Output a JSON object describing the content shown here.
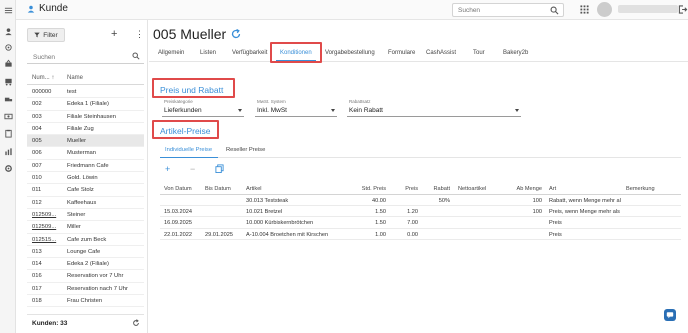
{
  "app": {
    "title": "Kunde"
  },
  "top": {
    "search_placeholder": "Suchen"
  },
  "listpanel": {
    "filter_label": "Filter",
    "search_placeholder": "Suchen",
    "col_num": "Num...",
    "col_name": "Name",
    "sort_indicator": "↑",
    "footer": "Kunden: 33",
    "rows": [
      {
        "num": "000000",
        "name": "test"
      },
      {
        "num": "002",
        "name": "Edeka 1 (Filiale)"
      },
      {
        "num": "003",
        "name": "Filiale Steinhausen"
      },
      {
        "num": "004",
        "name": "Filiale Zug"
      },
      {
        "num": "005",
        "name": "Mueller"
      },
      {
        "num": "006",
        "name": "Musterman"
      },
      {
        "num": "007",
        "name": "Friedmann Cafe"
      },
      {
        "num": "010",
        "name": "Gold. Löwin"
      },
      {
        "num": "011",
        "name": "Cafe Stolz"
      },
      {
        "num": "012",
        "name": "Kaffeehaus"
      },
      {
        "num": "012509...",
        "name": "Steiner"
      },
      {
        "num": "012509...",
        "name": "Miller"
      },
      {
        "num": "012515...",
        "name": "Cafe zum Beck"
      },
      {
        "num": "013",
        "name": "Lounge Cafe"
      },
      {
        "num": "014",
        "name": "Edeka 2 (Filiale)"
      },
      {
        "num": "016",
        "name": "Reservation vor 7 Uhr"
      },
      {
        "num": "017",
        "name": "Reservation nach 7 Uhr"
      },
      {
        "num": "018",
        "name": "Frau Christen"
      }
    ]
  },
  "main": {
    "title": "005 Mueller",
    "tabs": [
      "Allgemein",
      "Listen",
      "Verfügbarkeit",
      "Konditionen",
      "Vorgabebestellung",
      "Formulare",
      "CashAssist",
      "Tour",
      "Bakery2b"
    ],
    "active_tab": "Konditionen",
    "section_price": "Preis und Rabatt",
    "section_articles": "Artikel-Preise",
    "dropdowns": [
      {
        "label": "Preiskategorie",
        "value": "Lieferkunden"
      },
      {
        "label": "MwSt. System",
        "value": "Inkl. MwSt"
      },
      {
        "label": "Rabattsatz",
        "value": "Kein Rabatt"
      }
    ],
    "subtabs": [
      "Individuelle Preise",
      "Reseller Preise"
    ],
    "grid": {
      "headers": [
        "Von Datum",
        "Bis Datum",
        "Artikel",
        "Std. Preis",
        "Preis",
        "Rabatt",
        "Nettoartikel",
        "Ab Menge",
        "Art",
        "Bemerkung"
      ],
      "rows": [
        [
          "",
          "",
          "30.013 Teststeak",
          "40.00",
          "",
          "50%",
          "",
          "100",
          "Rabatt, wenn Menge mehr al",
          ""
        ],
        [
          "15.03.2024",
          "",
          "10.021 Bretzel",
          "1.50",
          "1.20",
          "",
          "",
          "100",
          "Preis, wenn Menge mehr als",
          ""
        ],
        [
          "16.09.2025",
          "",
          "10.000 Kürbiskernbrötchen",
          "1.50",
          "7.00",
          "",
          "",
          "",
          "Preis",
          ""
        ],
        [
          "22.01.2022",
          "29.01.2025",
          "A-10.004 Broetchen mit Kirschen",
          "1.00",
          "0.00",
          "",
          "",
          "",
          "Preis",
          ""
        ]
      ]
    }
  },
  "colors": {
    "accent": "#3a8fd8",
    "highlight_box": "#e04a4a"
  }
}
